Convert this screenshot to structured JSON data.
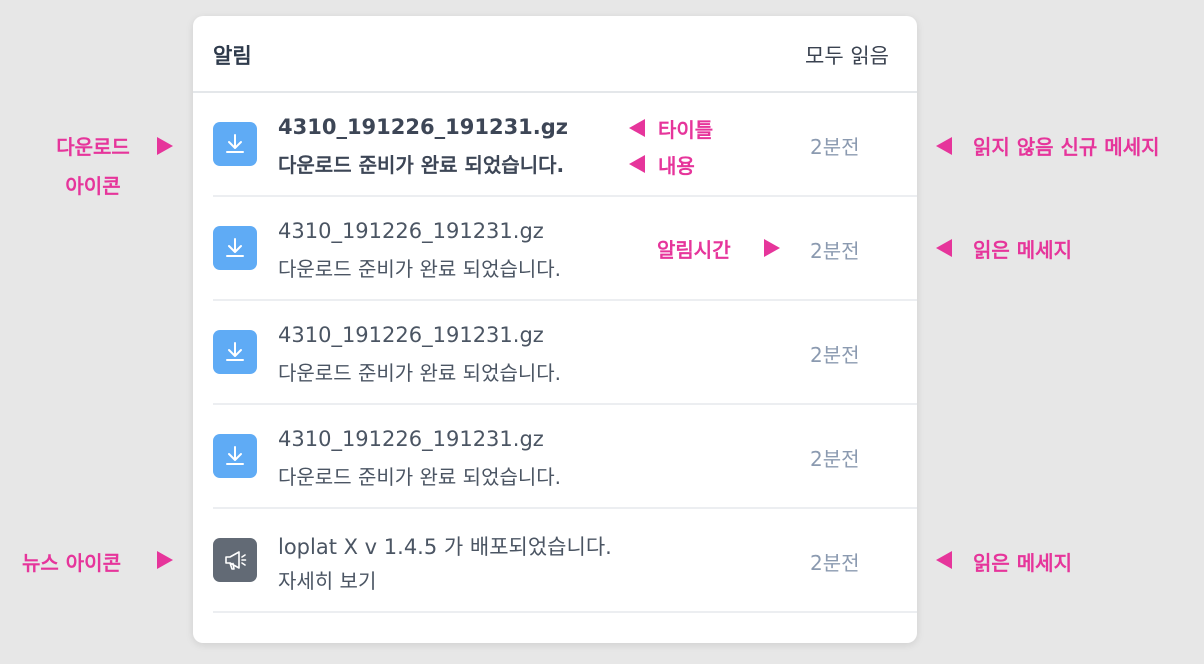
{
  "panel": {
    "title": "알림",
    "mark_all_read": "모두 읽음"
  },
  "notifications": [
    {
      "type": "download",
      "icon": "download-icon",
      "title": "4310_191226_191231.gz",
      "body": "다운로드 준비가 완료 되었습니다.",
      "time": "2분전",
      "unread": true
    },
    {
      "type": "download",
      "icon": "download-icon",
      "title": "4310_191226_191231.gz",
      "body": "다운로드 준비가 완료 되었습니다.",
      "time": "2분전",
      "unread": false
    },
    {
      "type": "download",
      "icon": "download-icon",
      "title": "4310_191226_191231.gz",
      "body": "다운로드 준비가 완료 되었습니다.",
      "time": "2분전",
      "unread": false
    },
    {
      "type": "download",
      "icon": "download-icon",
      "title": "4310_191226_191231.gz",
      "body": "다운로드 준비가 완료 되었습니다.",
      "time": "2분전",
      "unread": false
    },
    {
      "type": "news",
      "icon": "megaphone-icon",
      "title": "loplat X v 1.4.5 가 배포되었습니다.",
      "body": "자세히 보기",
      "time": "2분전",
      "unread": false
    }
  ],
  "annotations": {
    "download_icon_line1": "다운로드",
    "download_icon_line2": "아이콘",
    "title": "타이틀",
    "content": "내용",
    "unread_new": "읽지 않음 신규 메세지",
    "notif_time": "알림시간",
    "read_1": "읽은 메세지",
    "news_icon": "뉴스 아이콘",
    "read_2": "읽은 메세지"
  },
  "colors": {
    "background": "#e7e7e7",
    "download_icon": "#5fabf5",
    "news_icon": "#626a75",
    "annotation": "#e6359b",
    "time_text": "#8b9ab0"
  }
}
